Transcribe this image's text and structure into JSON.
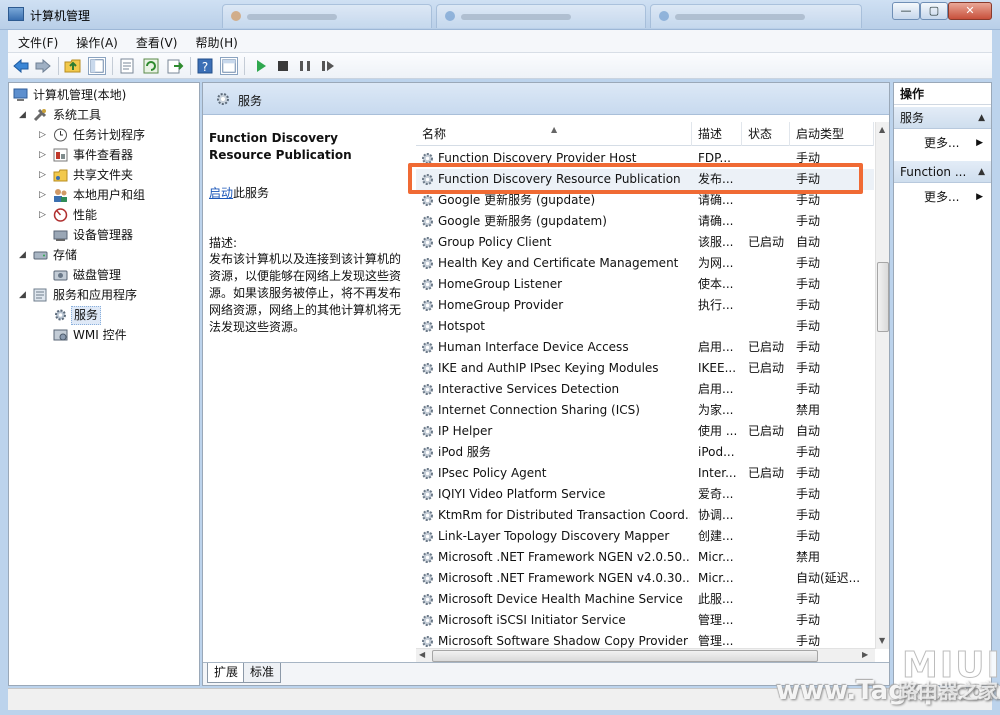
{
  "window": {
    "title": "计算机管理",
    "buttons": {
      "minimize": "—",
      "maximize": "▢",
      "close": "✕"
    }
  },
  "menu": [
    "文件(F)",
    "操作(A)",
    "查看(V)",
    "帮助(H)"
  ],
  "tree": {
    "root": "计算机管理(本地)",
    "system_tools": "系统工具",
    "task_scheduler": "任务计划程序",
    "event_viewer": "事件查看器",
    "shared_folders": "共享文件夹",
    "local_users": "本地用户和组",
    "performance": "性能",
    "device_manager": "设备管理器",
    "storage": "存储",
    "disk_management": "磁盘管理",
    "services_apps": "服务和应用程序",
    "services": "服务",
    "wmi": "WMI 控件"
  },
  "center": {
    "header": "服务",
    "desc_title": "Function Discovery Resource Publication",
    "start_link": "启动",
    "start_suffix": "此服务",
    "desc_label": "描述:",
    "desc_text": "发布该计算机以及连接到该计算机的资源，以便能够在网络上发现这些资源。如果该服务被停止，将不再发布网络资源，网络上的其他计算机将无法发现这些资源。"
  },
  "columns": {
    "name": "名称",
    "desc": "描述",
    "status": "状态",
    "startup": "启动类型"
  },
  "services": [
    {
      "name": "Function Discovery Provider Host",
      "desc": "FDP...",
      "status": "",
      "startup": "手动"
    },
    {
      "name": "Function Discovery Resource Publication",
      "desc": "发布...",
      "status": "",
      "startup": "手动"
    },
    {
      "name": "Google 更新服务 (gupdate)",
      "desc": "请确...",
      "status": "",
      "startup": "手动"
    },
    {
      "name": "Google 更新服务 (gupdatem)",
      "desc": "请确...",
      "status": "",
      "startup": "手动"
    },
    {
      "name": "Group Policy Client",
      "desc": "该服...",
      "status": "已启动",
      "startup": "自动"
    },
    {
      "name": "Health Key and Certificate Management",
      "desc": "为网...",
      "status": "",
      "startup": "手动"
    },
    {
      "name": "HomeGroup Listener",
      "desc": "使本...",
      "status": "",
      "startup": "手动"
    },
    {
      "name": "HomeGroup Provider",
      "desc": "执行...",
      "status": "",
      "startup": "手动"
    },
    {
      "name": "Hotspot",
      "desc": "",
      "status": "",
      "startup": "手动"
    },
    {
      "name": "Human Interface Device Access",
      "desc": "启用...",
      "status": "已启动",
      "startup": "手动"
    },
    {
      "name": "IKE and AuthIP IPsec Keying Modules",
      "desc": "IKEE...",
      "status": "已启动",
      "startup": "手动"
    },
    {
      "name": "Interactive Services Detection",
      "desc": "启用...",
      "status": "",
      "startup": "手动"
    },
    {
      "name": "Internet Connection Sharing (ICS)",
      "desc": "为家...",
      "status": "",
      "startup": "禁用"
    },
    {
      "name": "IP Helper",
      "desc": "使用 ...",
      "status": "已启动",
      "startup": "自动"
    },
    {
      "name": "iPod 服务",
      "desc": "iPod...",
      "status": "",
      "startup": "手动"
    },
    {
      "name": "IPsec Policy Agent",
      "desc": "Inter...",
      "status": "已启动",
      "startup": "手动"
    },
    {
      "name": "IQIYI Video Platform Service",
      "desc": "爱奇...",
      "status": "",
      "startup": "手动"
    },
    {
      "name": "KtmRm for Distributed Transaction Coord...",
      "desc": "协调...",
      "status": "",
      "startup": "手动"
    },
    {
      "name": "Link-Layer Topology Discovery Mapper",
      "desc": "创建...",
      "status": "",
      "startup": "手动"
    },
    {
      "name": "Microsoft .NET Framework NGEN v2.0.50...",
      "desc": "Micr...",
      "status": "",
      "startup": "禁用"
    },
    {
      "name": "Microsoft .NET Framework NGEN v4.0.30...",
      "desc": "Micr...",
      "status": "",
      "startup": "自动(延迟..."
    },
    {
      "name": "Microsoft Device Health Machine Service",
      "desc": "此服...",
      "status": "",
      "startup": "手动"
    },
    {
      "name": "Microsoft iSCSI Initiator Service",
      "desc": "管理...",
      "status": "",
      "startup": "手动"
    },
    {
      "name": "Microsoft Software Shadow Copy Provider",
      "desc": "管理...",
      "status": "",
      "startup": "手动"
    }
  ],
  "tabs": {
    "extended": "扩展",
    "standard": "标准"
  },
  "actions": {
    "header": "操作",
    "group1": "服务",
    "more1": "更多...",
    "group2": "Function ...",
    "more2": "更多..."
  },
  "watermark": {
    "brand": "MIUI",
    "url": "www.Tagxp.com",
    "cn": "路由器之家"
  },
  "colors": {
    "highlight": "#f06a34",
    "link": "#1a56b8"
  }
}
